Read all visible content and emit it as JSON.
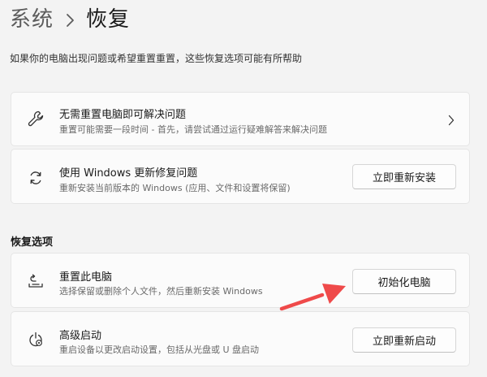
{
  "breadcrumb": {
    "parent": "系统",
    "current": "恢复"
  },
  "subtitle": "如果你的电脑出现问题或希望重置重置，这些恢复选项可能有所帮助",
  "cards": {
    "fix_without_reset": {
      "title": "无需重置电脑即可解决问题",
      "description": "重置可能需要一段时间 - 首先，请尝试通过运行疑难解答来解决问题",
      "icon": "wrench-icon"
    },
    "windows_update_fix": {
      "title": "使用 Windows 更新修复问题",
      "description": "重新安装当前版本的 Windows (应用、文件和设置将保留)",
      "button_label": "立即重新安装",
      "icon": "refresh-icon"
    }
  },
  "recovery_section": {
    "heading": "恢复选项",
    "reset_pc": {
      "title": "重置此电脑",
      "description": "选择保留或删除个人文件，然后重新安装 Windows",
      "button_label": "初始化电脑",
      "icon": "reset-pc-icon"
    },
    "advanced_startup": {
      "title": "高级启动",
      "description": "重启设备以更改启动设置，包括从光盘或 U 盘启动",
      "button_label": "立即重新启动",
      "icon": "advanced-startup-icon"
    }
  },
  "colors": {
    "background": "#f3f3f3",
    "card": "#fbfbfb",
    "annotation_arrow": "#ef4a4a"
  }
}
